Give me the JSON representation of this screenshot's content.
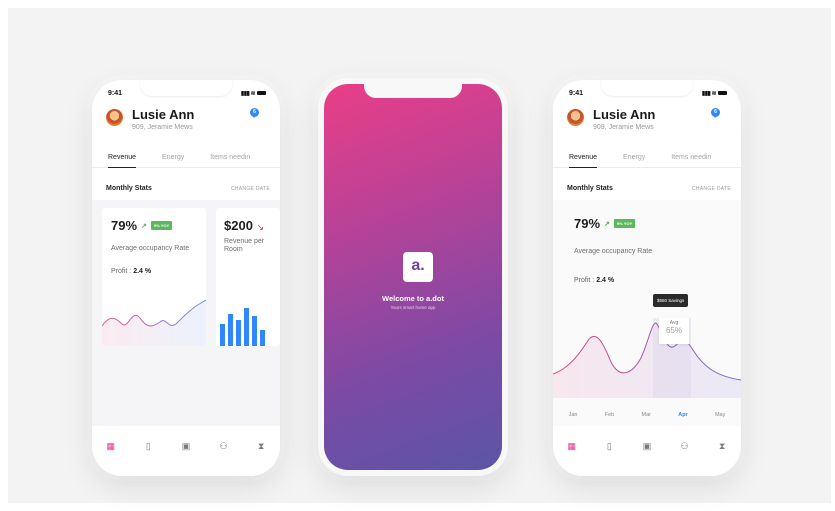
{
  "status": {
    "time": "9:41"
  },
  "profile": {
    "name": "Lusie Ann",
    "address": "909, Jeramie Mews",
    "notifications": "6"
  },
  "tabs": [
    {
      "label": "Revenue"
    },
    {
      "label": "Energy"
    },
    {
      "label": "Items needin"
    }
  ],
  "section": {
    "title": "Monthly Stats",
    "link": "CHANGE DATE"
  },
  "card1": {
    "value": "79%",
    "badge": "9% YOY",
    "desc": "Average occupancy Rate",
    "profit_label": "Profit :",
    "profit_value": "2.4 %"
  },
  "card2": {
    "value": "$200",
    "desc": "Revenue per Room"
  },
  "splash": {
    "logo": "a.",
    "welcome": "Welcome to a.dot",
    "tagline": "Yours smart home app"
  },
  "right_chart": {
    "tooltip": "$550 Savings",
    "avg_label": "Avg",
    "avg_value": "65%",
    "months": [
      "Jan",
      "Feb",
      "Mar",
      "Apr",
      "May"
    ],
    "selected_month": "Apr"
  },
  "nav": {
    "items": [
      "dashboard-icon",
      "book-icon",
      "briefcase-icon",
      "users-icon",
      "hourglass-icon"
    ]
  },
  "colors": {
    "accent": "#e0348b",
    "brand_blue": "#2f88ff",
    "gradient_top": "#ea3e87",
    "gradient_bottom": "#5b55a7"
  }
}
